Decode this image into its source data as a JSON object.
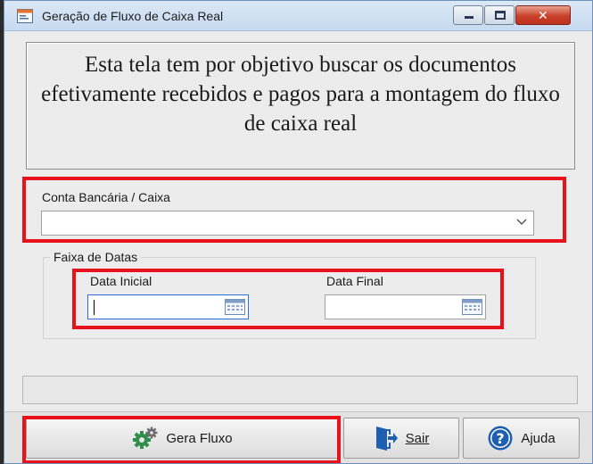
{
  "window": {
    "title": "Geração de Fluxo de Caixa Real",
    "icon": "window-app-icon"
  },
  "description": "Esta tela tem por objetivo buscar os documentos efetivamente recebidos e pagos para a montagem do fluxo de caixa real",
  "account": {
    "label": "Conta Bancária / Caixa",
    "value": ""
  },
  "date_range": {
    "group_label": "Faixa de Datas",
    "start_label": "Data Inicial",
    "start_value": "",
    "end_label": "Data Final",
    "end_value": ""
  },
  "status": "",
  "buttons": {
    "generate": {
      "label": "Gera Fluxo",
      "icon": "gears-icon"
    },
    "exit": {
      "label": "Sair",
      "icon": "exit-door-icon"
    },
    "help": {
      "label": "Ajuda",
      "icon": "help-question-icon"
    }
  },
  "colors": {
    "highlight": "#e8121c",
    "help_blue": "#1f5fb0",
    "gear_green": "#2f8f4a"
  }
}
